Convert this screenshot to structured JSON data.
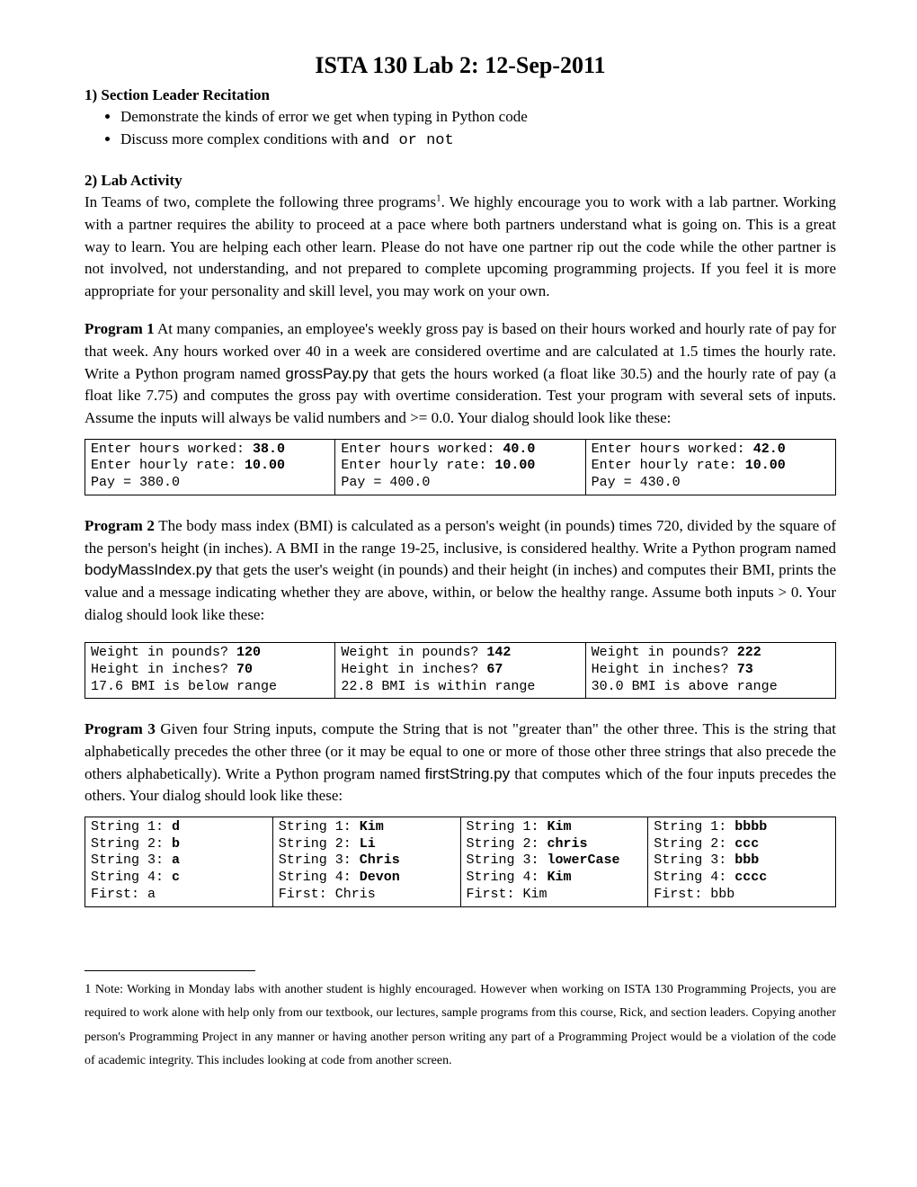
{
  "title": "ISTA 130 Lab 2: 12-Sep-2011",
  "section1": {
    "heading": "1) Section Leader Recitation",
    "bullets": [
      "Demonstrate the kinds of error we get when typing in Python code",
      "Discuss more complex conditions with "
    ],
    "bullet2_code": "and or not"
  },
  "section2": {
    "heading": "2) Lab Activity",
    "intro_a": "In Teams of two, complete the following three programs",
    "fnref": "1",
    "intro_b": ". We highly encourage you to work with a lab partner. Working with a partner requires the ability to proceed at a pace where both partners understand what is going on. This is a great way to learn. You are helping each other learn. Please do not have one partner rip out the code while the other partner is not involved, not understanding, and not prepared to complete upcoming programming projects.  If you feel it is more appropriate for your personality and skill level, you may work on your own."
  },
  "program1": {
    "lead": "Program 1",
    "text_a": " At many companies, an employee's weekly gross pay is based on their hours worked and hourly rate of pay for that week. Any hours worked over 40 in a week are considered overtime and are calculated at 1.5 times the hourly rate. Write a Python program named ",
    "filename": "grossPay.py",
    "text_b": " that gets the hours worked (a float like 30.5) and the hourly rate of pay (a float like 7.75) and computes the gross pay with overtime consideration. Test your program with several sets of inputs. Assume the inputs will always be valid numbers and >= 0.0. Your dialog should look like these:",
    "dialogs": [
      [
        {
          "label": "Enter hours worked: ",
          "val": "38.0"
        },
        {
          "label": "Enter hourly rate: ",
          "val": "10.00"
        },
        {
          "label": "Pay = 380.0",
          "val": ""
        }
      ],
      [
        {
          "label": "Enter hours worked: ",
          "val": "40.0"
        },
        {
          "label": "Enter hourly rate: ",
          "val": "10.00"
        },
        {
          "label": "Pay = 400.0",
          "val": ""
        }
      ],
      [
        {
          "label": "Enter hours worked: ",
          "val": "42.0"
        },
        {
          "label": "Enter hourly rate: ",
          "val": "10.00"
        },
        {
          "label": "Pay = 430.0",
          "val": ""
        }
      ]
    ]
  },
  "program2": {
    "lead": "Program 2",
    "text_a": " The body mass index (BMI) is calculated as a person's weight (in pounds) times 720, divided by the square of the person's height (in inches). A BMI in the range 19-25, inclusive, is considered healthy. Write a Python program named ",
    "filename": "bodyMassIndex.py",
    "text_b": " that gets the user's weight (in pounds) and their height (in inches) and computes their BMI,  prints the value and a message indicating whether they are above, within, or below the healthy range. Assume both inputs > 0. Your dialog should look like these:",
    "dialogs": [
      [
        {
          "label": "Weight in pounds? ",
          "val": "120"
        },
        {
          "label": "Height in inches? ",
          "val": "70"
        },
        {
          "label": "17.6 BMI is below range",
          "val": ""
        }
      ],
      [
        {
          "label": "Weight in pounds? ",
          "val": "142"
        },
        {
          "label": "Height in inches? ",
          "val": "67"
        },
        {
          "label": "22.8 BMI is within range",
          "val": ""
        }
      ],
      [
        {
          "label": "Weight in pounds? ",
          "val": "222"
        },
        {
          "label": "Height in inches? ",
          "val": "73"
        },
        {
          "label": "30.0 BMI is above range",
          "val": ""
        }
      ]
    ]
  },
  "program3": {
    "lead": "Program 3",
    "text_a": " Given four String inputs, compute the String that is not \"greater than\" the other three. This is the string that alphabetically precedes the other three (or it may be equal to one or more of those other three strings that also precede the others alphabetically). Write a Python program named ",
    "filename": "firstString.py",
    "text_b": " that computes which of the four inputs precedes the others. Your dialog should look like these:",
    "dialogs": [
      [
        {
          "label": "String 1: ",
          "val": "d"
        },
        {
          "label": "String 2: ",
          "val": "b"
        },
        {
          "label": "String 3: ",
          "val": "a"
        },
        {
          "label": "String 4: ",
          "val": "c"
        },
        {
          "label": "First: a",
          "val": ""
        }
      ],
      [
        {
          "label": "String 1: ",
          "val": "Kim"
        },
        {
          "label": "String 2: ",
          "val": "Li"
        },
        {
          "label": "String 3: ",
          "val": "Chris"
        },
        {
          "label": "String 4: ",
          "val": "Devon"
        },
        {
          "label": "First: Chris",
          "val": ""
        }
      ],
      [
        {
          "label": "String 1: ",
          "val": "Kim"
        },
        {
          "label": "String 2: ",
          "val": "chris"
        },
        {
          "label": "String 3: ",
          "val": "lowerCase"
        },
        {
          "label": "String 4: ",
          "val": "Kim"
        },
        {
          "label": "First: Kim",
          "val": ""
        }
      ],
      [
        {
          "label": "String 1: ",
          "val": "bbbb"
        },
        {
          "label": "String 2: ",
          "val": "ccc"
        },
        {
          "label": "String 3: ",
          "val": "bbb"
        },
        {
          "label": "String 4: ",
          "val": "cccc"
        },
        {
          "label": "First: bbb",
          "val": ""
        }
      ]
    ]
  },
  "footnote": {
    "num": "1",
    "text": " Note: Working in Monday labs with another student is highly encouraged.  However when working on ISTA 130 Programming Projects, you are required to work alone with help only from our textbook, our lectures, sample programs from this course, Rick, and section leaders. Copying another person's Programming Project in any manner or having another person writing any part of a Programming Project would be a violation of the code of academic integrity. This includes looking at code from another screen."
  }
}
